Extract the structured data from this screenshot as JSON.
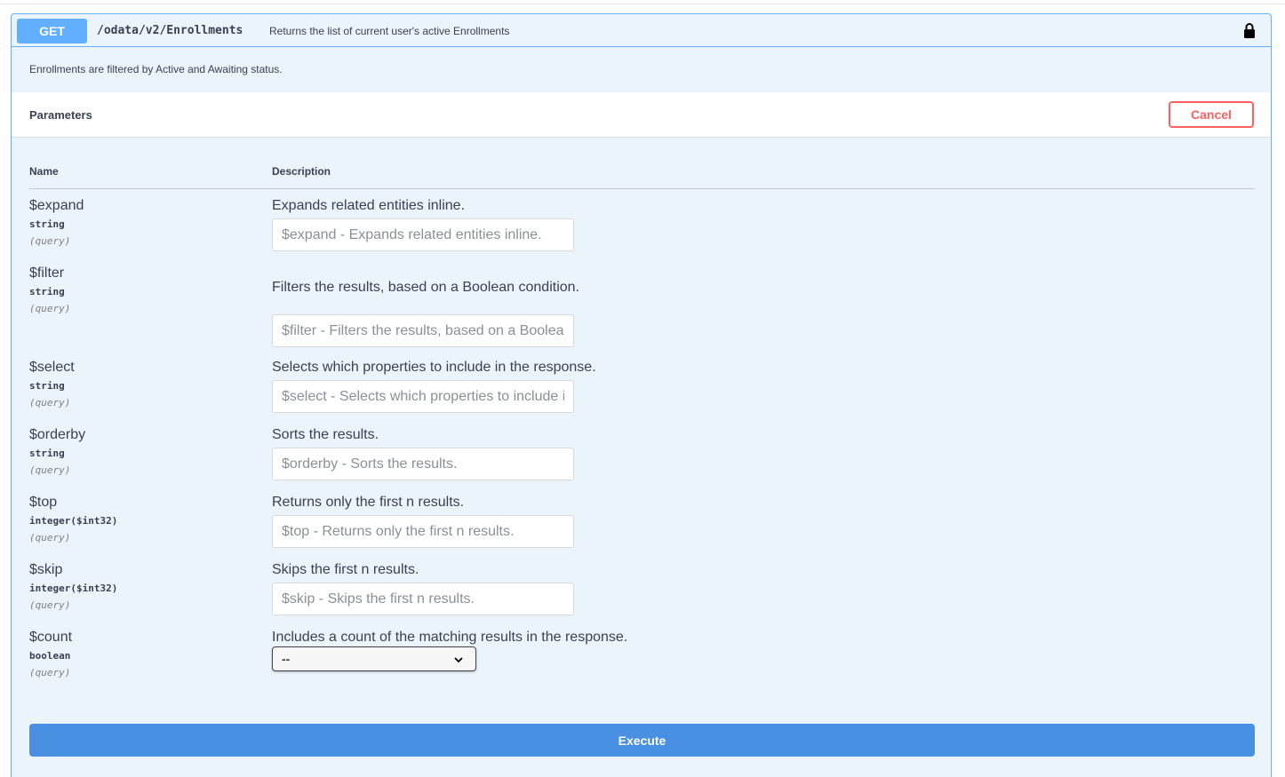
{
  "endpoint": {
    "method": "GET",
    "path": "/odata/v2/Enrollments",
    "summary": "Returns the list of current user's active Enrollments",
    "description": "Enrollments are filtered by Active and Awaiting status.",
    "lock_icon": "lock-icon"
  },
  "parameters": {
    "title": "Parameters",
    "cancel_label": "Cancel",
    "col_name": "Name",
    "col_description": "Description",
    "items": [
      {
        "name": "$expand",
        "type": "string",
        "in": "(query)",
        "description": "Expands related entities inline.",
        "placeholder": "$expand - Expands related entities inline."
      },
      {
        "name": "$filter",
        "type": "string",
        "in": "(query)",
        "description": "Filters the results, based on a Boolean condition.",
        "placeholder": "$filter - Filters the results, based on a Boolean condition."
      },
      {
        "name": "$select",
        "type": "string",
        "in": "(query)",
        "description": "Selects which properties to include in the response.",
        "placeholder": "$select - Selects which properties to include in the response."
      },
      {
        "name": "$orderby",
        "type": "string",
        "in": "(query)",
        "description": "Sorts the results.",
        "placeholder": "$orderby - Sorts the results."
      },
      {
        "name": "$top",
        "type": "integer($int32)",
        "in": "(query)",
        "description": "Returns only the first n results.",
        "placeholder": "$top - Returns only the first n results."
      },
      {
        "name": "$skip",
        "type": "integer($int32)",
        "in": "(query)",
        "description": "Skips the first n results.",
        "placeholder": "$skip - Skips the first n results."
      },
      {
        "name": "$count",
        "type": "boolean",
        "in": "(query)",
        "description": "Includes a count of the matching results in the response.",
        "selected": "--"
      }
    ]
  },
  "execute_label": "Execute",
  "colors": {
    "get_method": "#61affe",
    "cancel": "#ff6060",
    "execute": "#4990e2",
    "panel_bg": "#ebf3fb"
  }
}
